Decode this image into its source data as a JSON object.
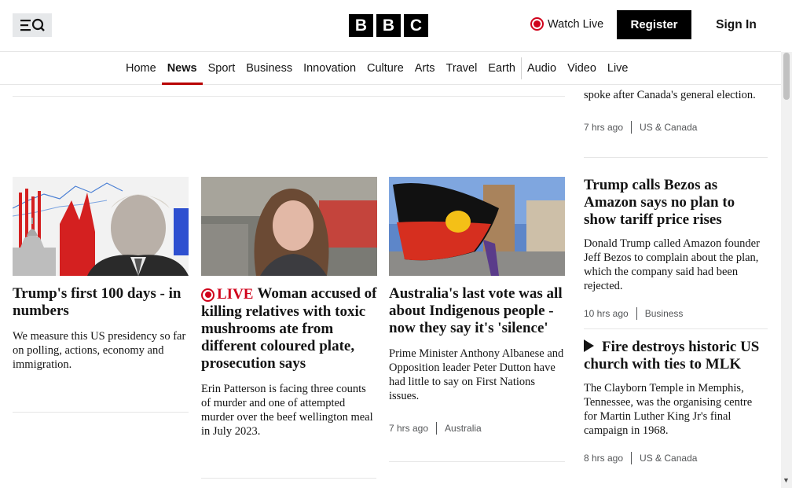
{
  "header": {
    "logo_letters": [
      "B",
      "B",
      "C"
    ],
    "watch_live_label": "Watch Live",
    "register_label": "Register",
    "signin_label": "Sign In",
    "menu_icon": "menu-search-icon"
  },
  "nav": {
    "items": [
      {
        "label": "Home"
      },
      {
        "label": "News",
        "active": true
      },
      {
        "label": "Sport"
      },
      {
        "label": "Business"
      },
      {
        "label": "Innovation"
      },
      {
        "label": "Culture"
      },
      {
        "label": "Arts"
      },
      {
        "label": "Travel"
      },
      {
        "label": "Earth"
      },
      {
        "label": "Audio"
      },
      {
        "label": "Video"
      },
      {
        "label": "Live"
      }
    ]
  },
  "cards": [
    {
      "headline": "Trump's first 100 days - in numbers",
      "summary": "We measure this US presidency so far on polling, actions, economy and immigration."
    },
    {
      "live_label": "LIVE",
      "headline": "Woman accused of killing relatives with toxic mushrooms ate from different coloured plate, prosecution says",
      "summary": "Erin Patterson is facing three counts of murder and one of attempted murder over the beef wellington meal in July 2023."
    },
    {
      "headline": "Australia's last vote was all about Indigenous people - now they say it's 'silence'",
      "summary": "Prime Minister Anthony Albanese and Opposition leader Peter Dutton have had little to say on First Nations issues.",
      "time": "7 hrs ago",
      "section": "Australia"
    }
  ],
  "right_column": {
    "top_partial": {
      "summary_tail": "spoke after Canada's general election.",
      "time": "7 hrs ago",
      "section": "US & Canada"
    },
    "stories": [
      {
        "headline": "Trump calls Bezos as Amazon says no plan to show tariff price rises",
        "summary": "Donald Trump called Amazon founder Jeff Bezos to complain about the plan, which the company said had been rejected.",
        "time": "10 hrs ago",
        "section": "Business"
      },
      {
        "icon": "play-icon",
        "headline": "Fire destroys historic US church with ties to MLK",
        "summary": "The Clayborn Temple in Memphis, Tennessee, was the organising centre for Martin Luther King Jr's final campaign in 1968.",
        "time": "8 hrs ago",
        "section": "US & Canada"
      }
    ]
  },
  "colors": {
    "accent_red": "#b80000",
    "live_red": "#d0021b",
    "black": "#000000"
  }
}
